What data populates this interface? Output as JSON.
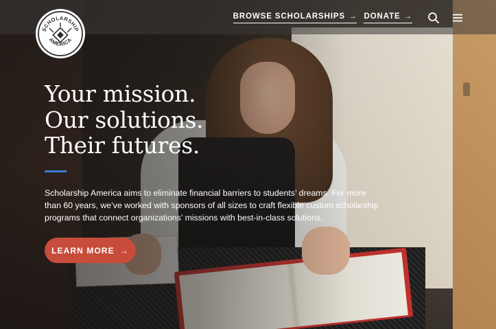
{
  "brand": {
    "logo_top": "SCHOLARSHIP",
    "logo_bottom": "AMERICA"
  },
  "nav": {
    "links": [
      {
        "label": "BROWSE SCHOLARSHIPS",
        "arrow": "→"
      },
      {
        "label": "DONATE",
        "arrow": "→"
      }
    ],
    "icons": [
      "search-icon",
      "menu-icon"
    ]
  },
  "hero": {
    "headline_lines": [
      "Your mission.",
      "Our solutions.",
      "Their futures."
    ],
    "body": "Scholarship America aims to eliminate financial barriers to students’ dreams. For more than 60 years, we’ve worked with sponsors of all sizes to craft flexible custom scholarship programs that connect organizations’ missions with best-in-class solutions.",
    "cta_label": "LEARN MORE",
    "cta_arrow": "→"
  },
  "colors": {
    "accent_cta": "#c74c3b",
    "accent_rule": "#3b7bd6",
    "text": "#ffffff"
  }
}
